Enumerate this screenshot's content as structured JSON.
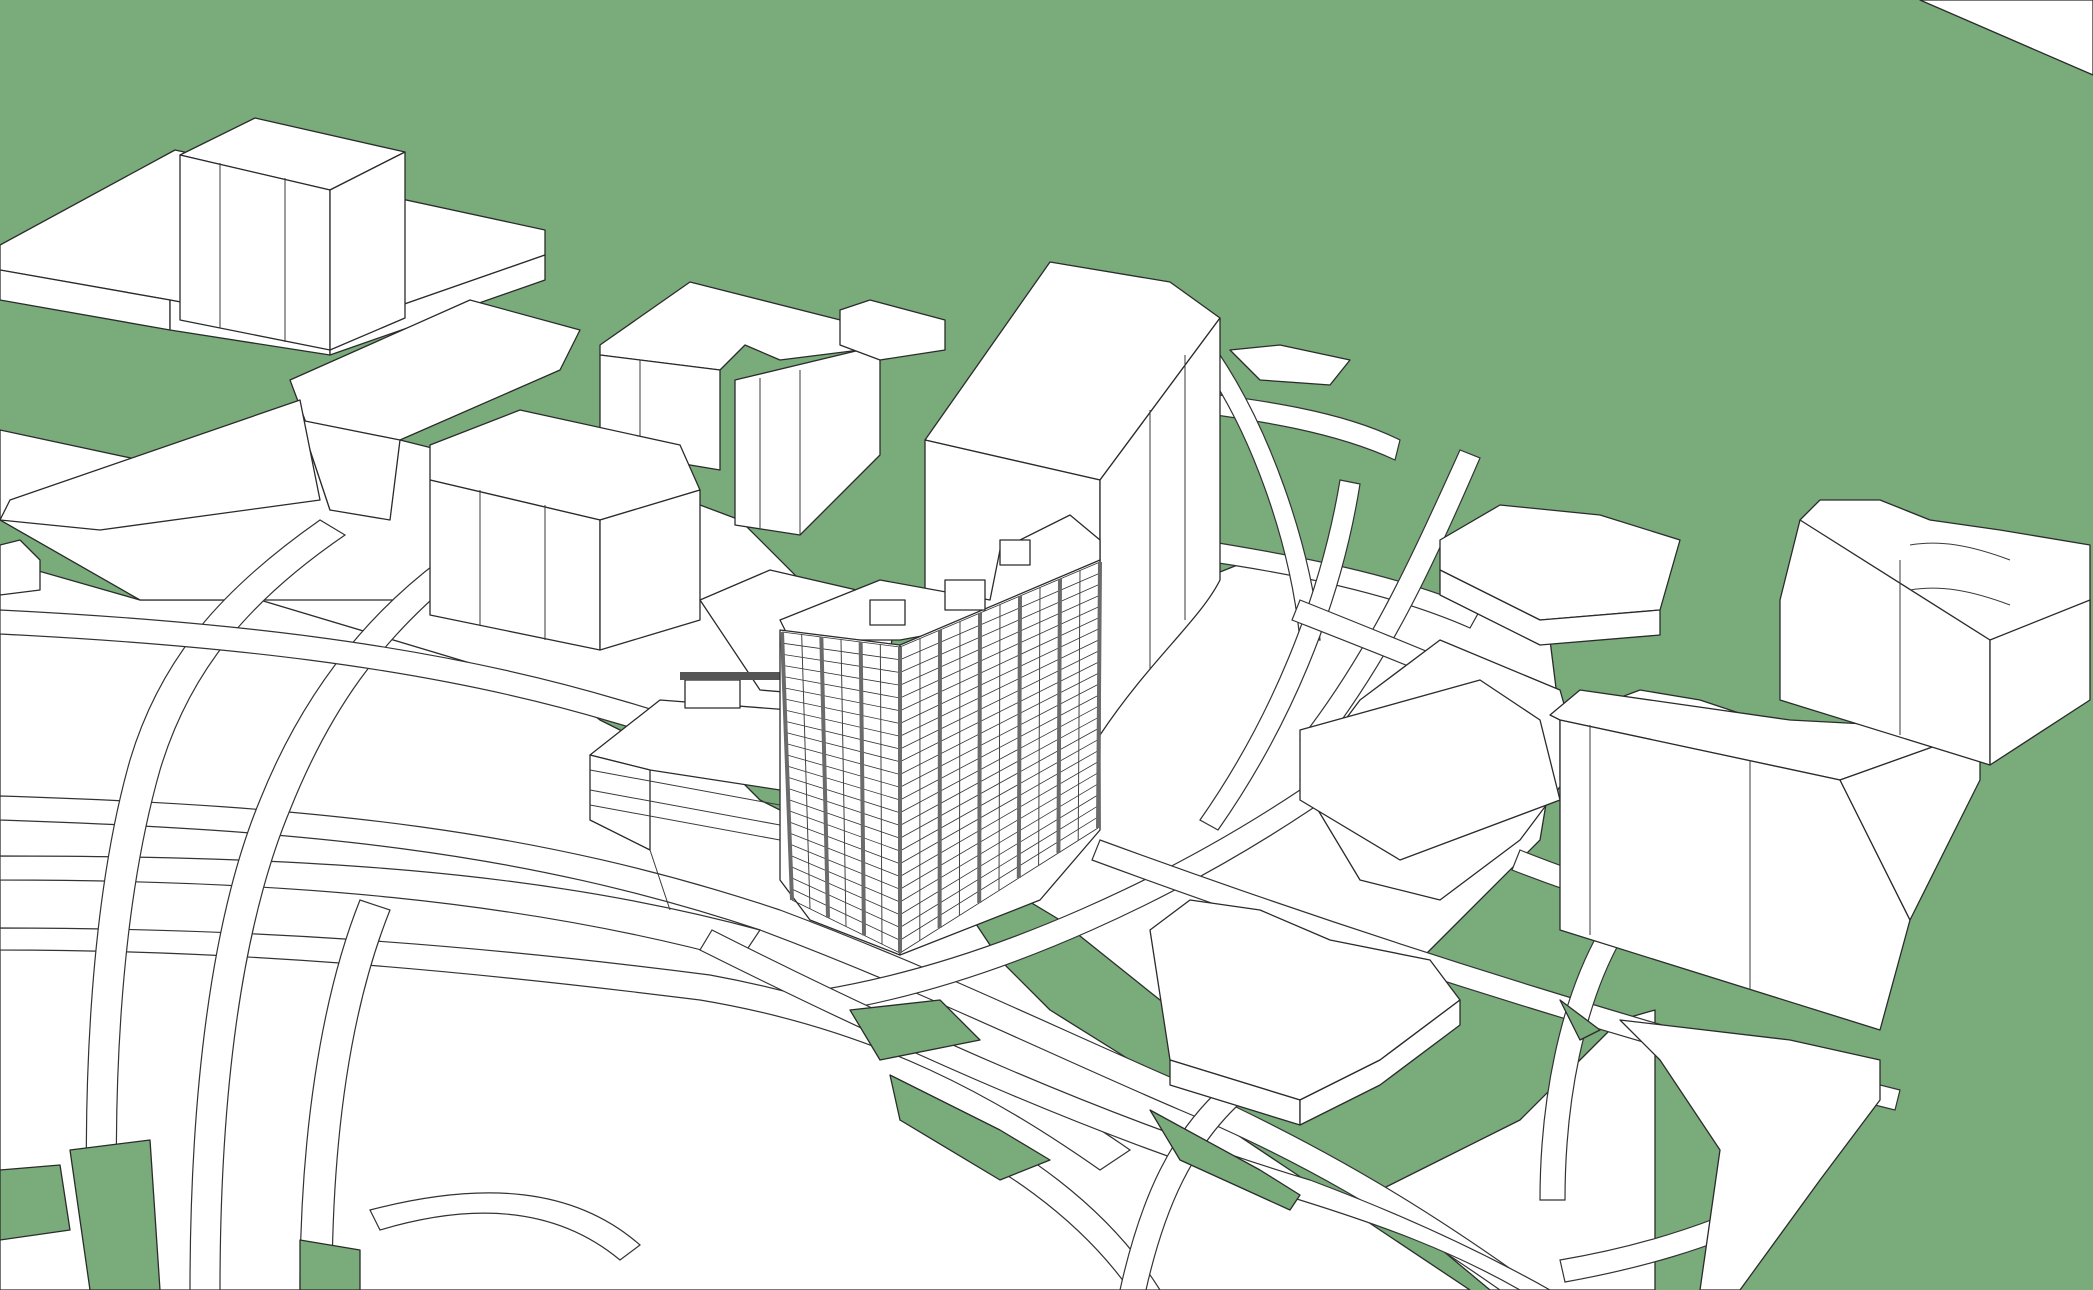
{
  "colors": {
    "ground": "#79ab7b",
    "building": "#ffffff",
    "outline": "#2b2b2b",
    "facade_dark": "#6b6b6b"
  },
  "scene": {
    "kind": "3d-massing-model",
    "highlighted_building": "residential-tower",
    "tower_floors": 24,
    "tower_bays": 16
  }
}
